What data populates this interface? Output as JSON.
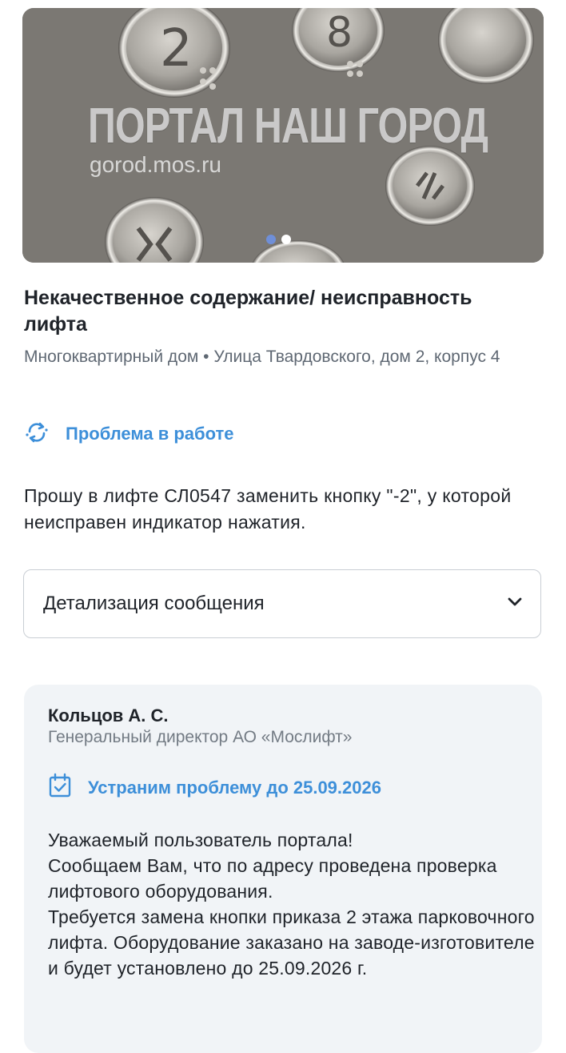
{
  "gallery": {
    "watermark_title": "ПОРТАЛ НАШ ГОРОД",
    "watermark_url": "gorod.mos.ru",
    "pages": 2,
    "current_page": 1
  },
  "problem": {
    "title": "Некачественное содержание/ неисправность лифта",
    "address": "Многоквартирный дом • Улица Твардовского, дом 2, корпус 4",
    "status": "Проблема в работе",
    "description": "Прошу в лифте СЛ0547 заменить кнопку \"-2\", у которой неисправен индикатор нажатия."
  },
  "details": {
    "label": "Детализация сообщения"
  },
  "response": {
    "name": "Кольцов А. С.",
    "role": "Генеральный директор АО «Мослифт»",
    "deadline": "Устраним проблему до 25.09.2026",
    "text": "Уважаемый пользователь портала!\nСообщаем Вам, что по адресу проведена проверка лифтового оборудования.\nТребуется замена кнопки приказа 2 этажа парковочного лифта. Оборудование заказано на заводе-изготовителе и будет установлено до 25.09.2026 г."
  },
  "colors": {
    "accent": "#3d8fd9",
    "text": "#1f2329",
    "secondary_text": "#5f6873",
    "card_background": "#f1f4f7"
  },
  "icons": {
    "status": "refresh-cycle-icon",
    "details_toggle": "chevron-down-icon",
    "deadline": "calendar-check-icon"
  }
}
